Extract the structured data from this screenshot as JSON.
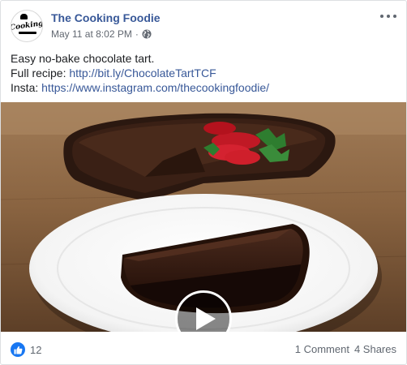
{
  "post": {
    "page_name": "The Cooking Foodie",
    "avatar": {
      "logo_text": "Cooking",
      "icon": "chef-hat-logo"
    },
    "timestamp": "May 11 at 8:02 PM",
    "separator": "·",
    "privacy_icon": "globe-icon",
    "more_icon": "more-options-icon",
    "text": {
      "line1": "Easy no-bake chocolate tart.",
      "line2_prefix": "Full recipe: ",
      "line2_link": "http://bit.ly/ChocolateTartTCF",
      "line3_prefix": "Insta: ",
      "line3_link": "https://www.instagram.com/thecookingfoodie/"
    },
    "media": {
      "type": "video",
      "play_icon": "play-icon"
    },
    "footer": {
      "reaction_icon": "like-icon",
      "reaction_count": "12",
      "comments": "1 Comment",
      "shares": "4 Shares"
    }
  },
  "colors": {
    "link": "#385898",
    "text": "#1c1e21",
    "muted": "#616770",
    "like_blue": "#1877f2",
    "border": "#dddfe2"
  }
}
